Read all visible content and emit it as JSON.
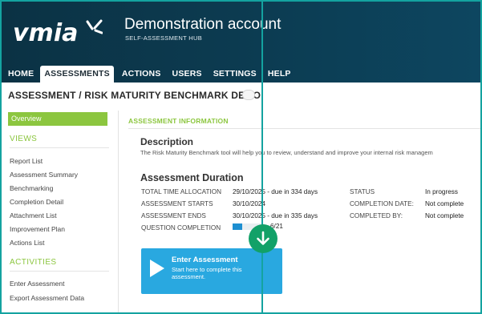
{
  "header": {
    "logo_text": "vmia",
    "account_title": "Demonstration account",
    "account_subtitle": "SELF-ASSESSMENT HUB"
  },
  "nav": {
    "items": [
      "HOME",
      "ASSESSMENTS",
      "ACTIONS",
      "USERS",
      "SETTINGS",
      "HELP"
    ],
    "active": "ASSESSMENTS"
  },
  "page": {
    "title": "ASSESSMENT / RISK MATURITY BENCHMARK DEMO"
  },
  "sidebar": {
    "active_item": "Overview",
    "views_heading": "VIEWS",
    "views": [
      "Report List",
      "Assessment Summary",
      "Benchmarking",
      "Completion Detail",
      "Attachment List",
      "Improvement Plan",
      "Actions List"
    ],
    "activities_heading": "ACTIVITIES",
    "activities": [
      "Enter Assessment",
      "Export Assessment Data"
    ]
  },
  "main": {
    "section_tab": "ASSESSMENT INFORMATION",
    "description_heading": "Description",
    "description_text": "The Risk Maturity Benchmark tool will help you to review, understand and improve your internal risk managem",
    "duration_heading": "Assessment Duration",
    "rows_left": [
      {
        "label": "TOTAL TIME ALLOCATION",
        "value": "29/10/2025 - due in 334 days"
      },
      {
        "label": "ASSESSMENT STARTS",
        "value": "30/10/2024"
      },
      {
        "label": "ASSESSMENT ENDS",
        "value": "30/10/2025 - due in 335 days"
      },
      {
        "label": "QUESTION COMPLETION",
        "value": ""
      }
    ],
    "rows_right": [
      {
        "label": "STATUS",
        "value": "In progress"
      },
      {
        "label": "COMPLETION DATE:",
        "value": "Not complete"
      },
      {
        "label": "COMPLETED BY:",
        "value": "Not complete"
      }
    ],
    "question_completion_text": "6/21",
    "question_completion_fraction": 0.29,
    "enter_card": {
      "title": "Enter Assessment",
      "subtitle": "Start here to complete this assessment."
    }
  },
  "colors": {
    "header_bg": "#0c3c52",
    "accent_green": "#8cc63f",
    "card_blue": "#29a8e0",
    "overlay_teal": "#14a3a0",
    "marker_green": "#12a168"
  },
  "icons": [
    "vmia-logo-mark",
    "play-icon",
    "arrow-down-icon"
  ]
}
